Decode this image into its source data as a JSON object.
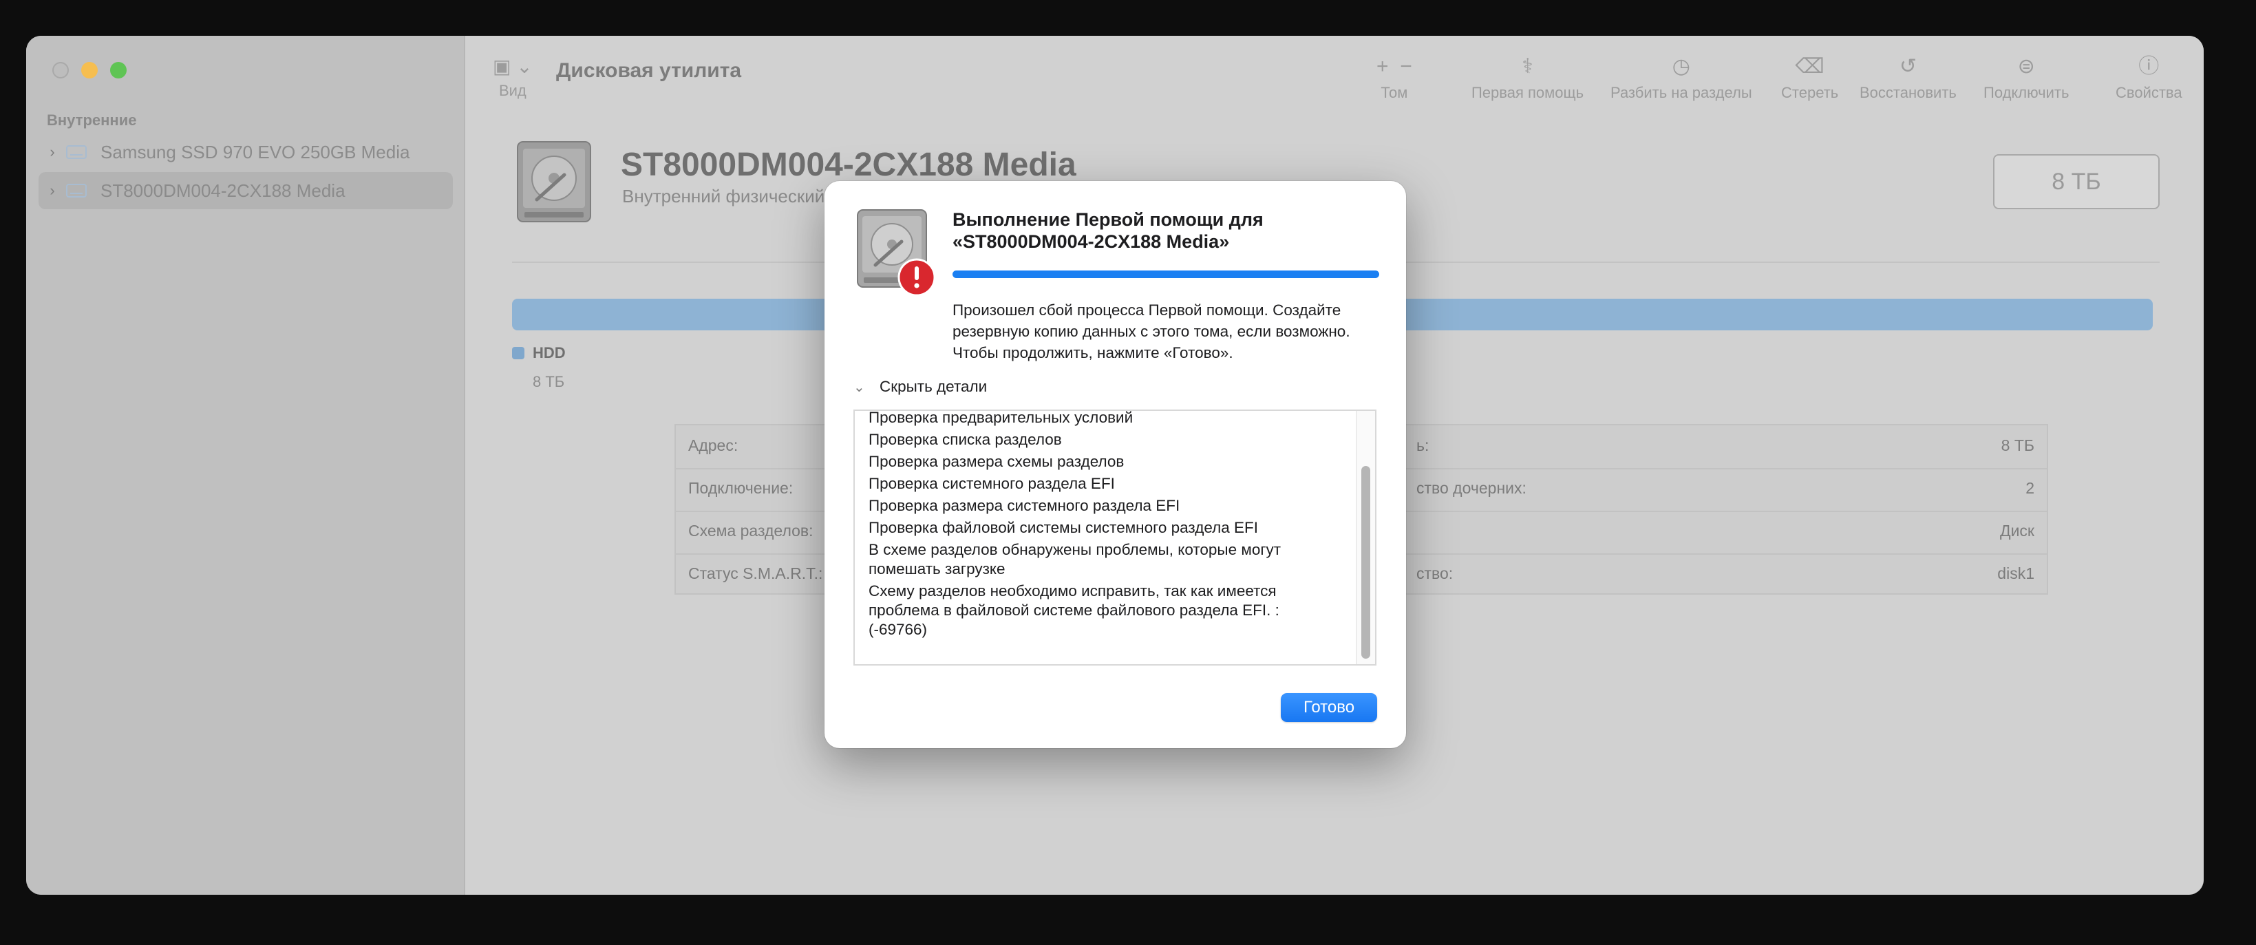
{
  "window": {
    "app_title": "Дисковая утилита",
    "sidebar": {
      "section_label": "Внутренние",
      "items": [
        {
          "label": "Samsung SSD 970 EVO 250GB Media",
          "selected": false
        },
        {
          "label": "ST8000DM004-2CX188 Media",
          "selected": true
        }
      ]
    },
    "toolbar": {
      "view_label": "Вид",
      "volume_label": "Том",
      "first_aid_label": "Первая помощь",
      "partition_label": "Разбить на разделы",
      "erase_label": "Стереть",
      "restore_label": "Восстановить",
      "mount_label": "Подключить",
      "info_label": "Свойства",
      "icons": [
        "sidebar-icon",
        "plus-icon",
        "minus-icon",
        "stethoscope-icon",
        "pie-chart-icon",
        "eraser-icon",
        "restore-icon",
        "mount-icon",
        "info-icon"
      ]
    },
    "disk": {
      "name": "ST8000DM004-2CX188 Media",
      "subtitle": "Внутренний физический",
      "size": "8 ТБ",
      "legend_name": "HDD",
      "legend_size": "8 ТБ",
      "usage_color": "#8eb3d4"
    },
    "info": {
      "rows": [
        {
          "label": "Адрес:",
          "value": "",
          "label2": "ь:",
          "value2": "8 ТБ"
        },
        {
          "label": "Подключение:",
          "value": "",
          "label2": "ство дочерних:",
          "value2": "2"
        },
        {
          "label": "Схема разделов:",
          "value": "",
          "label2": "",
          "value2": "Диск"
        },
        {
          "label": "Статус S.M.A.R.T.:",
          "value": "",
          "label2": "ство:",
          "value2": "disk1"
        }
      ]
    }
  },
  "dialog": {
    "title": "Выполнение Первой помощи для «ST8000DM004-2CX188 Media»",
    "progress": 1.0,
    "accent": "#1a7ff2",
    "message": "Произошел сбой процесса Первой помощи. Создайте резервную копию данных с этого тома, если возможно. Чтобы продолжить, нажмите «Готово».",
    "details_toggle": "Скрыть детали",
    "log": [
      "Проверка предварительных условий",
      "Проверка списка разделов",
      "Проверка размера схемы разделов",
      "Проверка системного раздела EFI",
      "Проверка размера системного раздела EFI",
      "Проверка файловой системы системного раздела EFI",
      "В схеме разделов обнаружены проблемы, которые могут помешать загрузке",
      "Схему разделов необходимо исправить, так как имеется проблема в файловой системе файлового раздела EFI. : (-69766)"
    ],
    "done_label": "Готово",
    "alert_color": "#d9272e"
  }
}
